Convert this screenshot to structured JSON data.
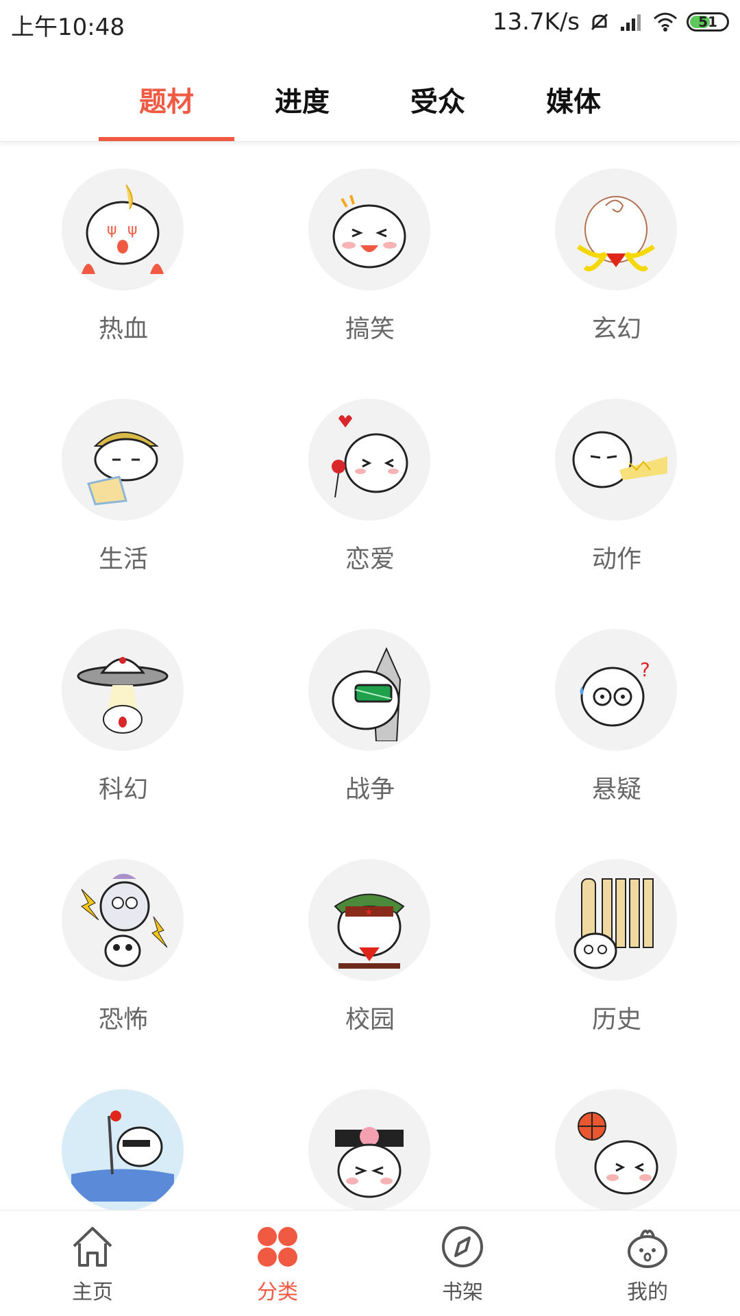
{
  "status_bar": {
    "time": "上午10:48",
    "net_speed": "13.7K/s",
    "battery_level": "51",
    "icons": [
      "mute-icon",
      "signal-icon",
      "wifi-icon",
      "battery-icon"
    ]
  },
  "tabs": [
    {
      "label": "题材",
      "active": true
    },
    {
      "label": "进度",
      "active": false
    },
    {
      "label": "受众",
      "active": false
    },
    {
      "label": "媒体",
      "active": false
    }
  ],
  "categories": [
    {
      "label": "热血",
      "icon": "hot-blood-icon"
    },
    {
      "label": "搞笑",
      "icon": "funny-icon"
    },
    {
      "label": "玄幻",
      "icon": "fantasy-icon"
    },
    {
      "label": "生活",
      "icon": "life-icon"
    },
    {
      "label": "恋爱",
      "icon": "romance-icon"
    },
    {
      "label": "动作",
      "icon": "action-icon"
    },
    {
      "label": "科幻",
      "icon": "scifi-icon"
    },
    {
      "label": "战争",
      "icon": "war-icon"
    },
    {
      "label": "悬疑",
      "icon": "mystery-icon"
    },
    {
      "label": "恐怖",
      "icon": "horror-icon"
    },
    {
      "label": "校园",
      "icon": "campus-icon"
    },
    {
      "label": "历史",
      "icon": "history-icon"
    },
    {
      "label": "",
      "icon": "partial-icon-1"
    },
    {
      "label": "",
      "icon": "partial-icon-2"
    },
    {
      "label": "",
      "icon": "partial-icon-3"
    }
  ],
  "bottom_nav": [
    {
      "label": "主页",
      "icon": "home-icon",
      "active": false
    },
    {
      "label": "分类",
      "icon": "category-icon",
      "active": true
    },
    {
      "label": "书架",
      "icon": "compass-icon",
      "active": false
    },
    {
      "label": "我的",
      "icon": "profile-icon",
      "active": false
    }
  ],
  "colors": {
    "accent": "#f05a43",
    "tab_text": "#111111",
    "label_text": "#666666",
    "avatar_bg": "#f2f2f2"
  }
}
